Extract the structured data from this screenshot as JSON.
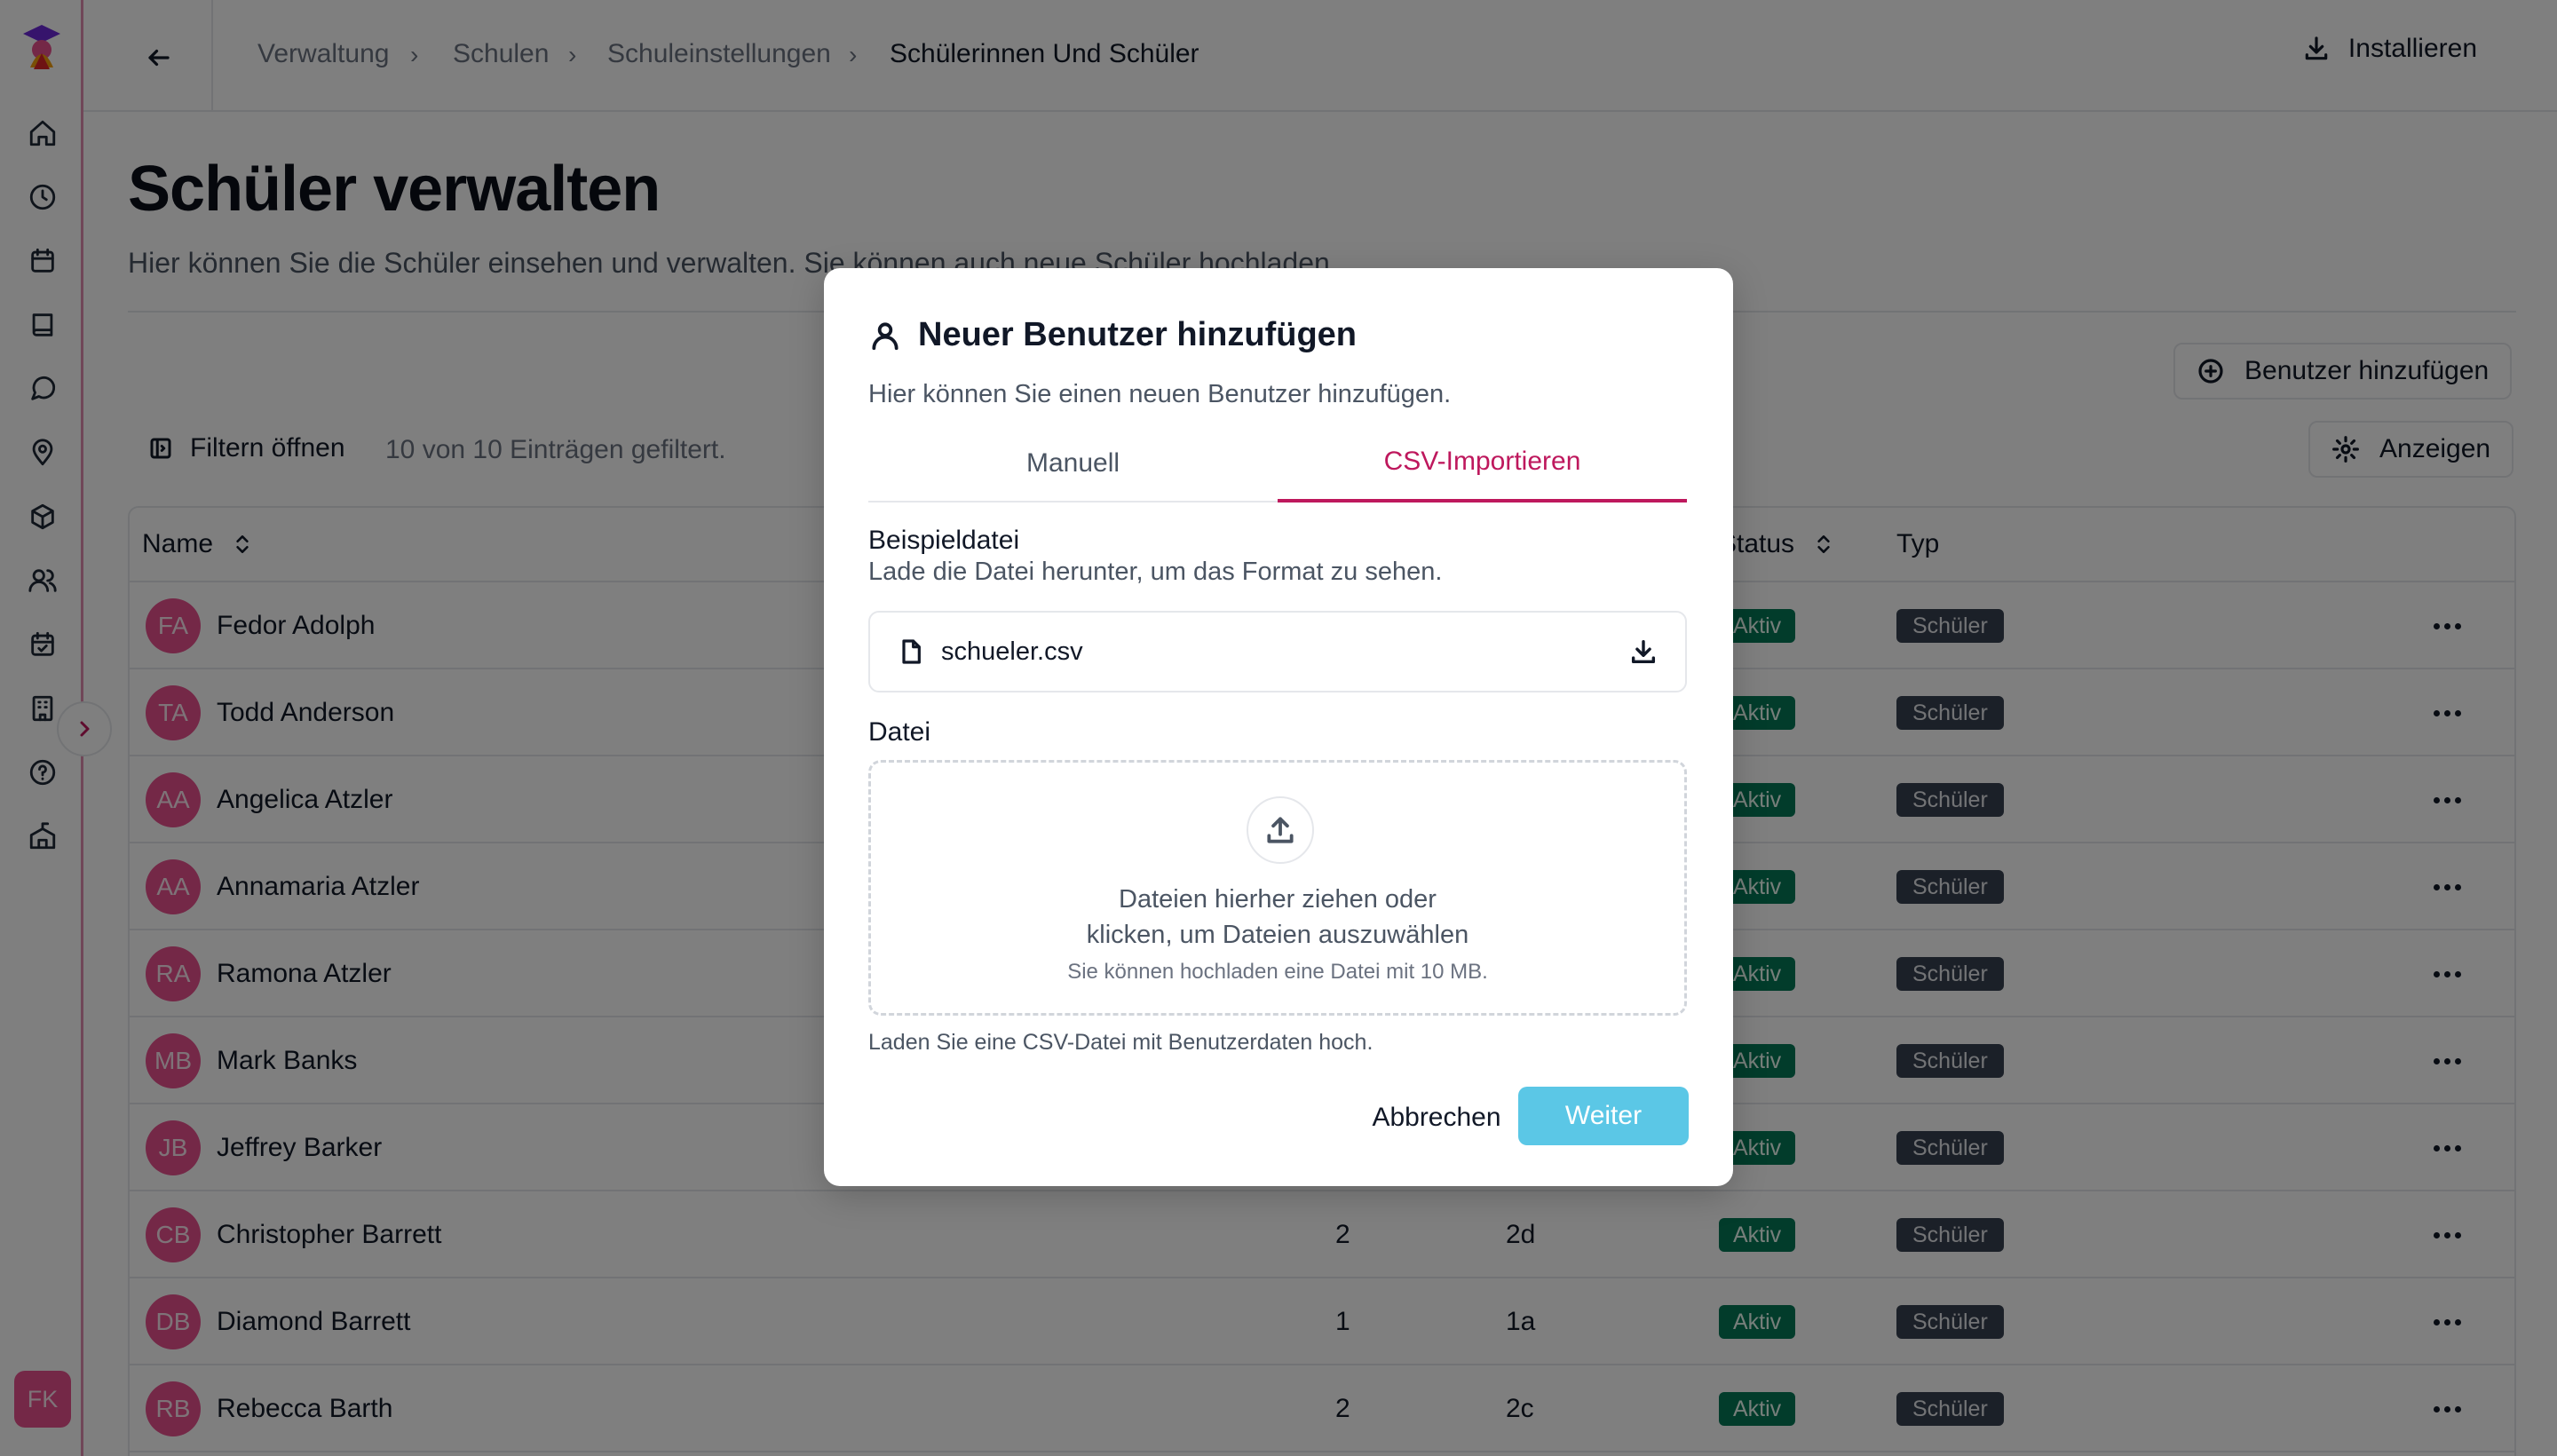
{
  "user": {
    "initials": "FK"
  },
  "breadcrumb": [
    "Verwaltung",
    "Schulen",
    "Schuleinstellungen",
    "Schülerinnen Und Schüler"
  ],
  "header": {
    "install_label": "Installieren"
  },
  "page": {
    "title": "Schüler verwalten",
    "description": "Hier können Sie die Schüler einsehen und verwalten. Sie können auch neue Schüler hochladen."
  },
  "toolbar": {
    "add_user_label": "Benutzer hinzufügen",
    "filter_label": "Filtern öffnen",
    "filter_count": "10 von 10 Einträgen gefiltert.",
    "view_label": "Anzeigen"
  },
  "table": {
    "headers": {
      "name": "Name",
      "status": "Status",
      "type": "Typ"
    },
    "rows": [
      {
        "initials": "FA",
        "name": "Fedor Adolph",
        "c1": "",
        "c2": "",
        "status": "Aktiv",
        "type": "Schüler"
      },
      {
        "initials": "TA",
        "name": "Todd Anderson",
        "c1": "",
        "c2": "",
        "status": "Aktiv",
        "type": "Schüler"
      },
      {
        "initials": "AA",
        "name": "Angelica Atzler",
        "c1": "",
        "c2": "",
        "status": "Aktiv",
        "type": "Schüler"
      },
      {
        "initials": "AA",
        "name": "Annamaria Atzler",
        "c1": "",
        "c2": "",
        "status": "Aktiv",
        "type": "Schüler"
      },
      {
        "initials": "RA",
        "name": "Ramona Atzler",
        "c1": "",
        "c2": "",
        "status": "Aktiv",
        "type": "Schüler"
      },
      {
        "initials": "MB",
        "name": "Mark Banks",
        "c1": "",
        "c2": "",
        "status": "Aktiv",
        "type": "Schüler"
      },
      {
        "initials": "JB",
        "name": "Jeffrey Barker",
        "c1": "",
        "c2": "",
        "status": "Aktiv",
        "type": "Schüler"
      },
      {
        "initials": "CB",
        "name": "Christopher Barrett",
        "c1": "2",
        "c2": "2d",
        "status": "Aktiv",
        "type": "Schüler"
      },
      {
        "initials": "DB",
        "name": "Diamond Barrett",
        "c1": "1",
        "c2": "1a",
        "status": "Aktiv",
        "type": "Schüler"
      },
      {
        "initials": "RB",
        "name": "Rebecca Barth",
        "c1": "2",
        "c2": "2c",
        "status": "Aktiv",
        "type": "Schüler"
      }
    ]
  },
  "dialog": {
    "title": "Neuer Benutzer hinzufügen",
    "description": "Hier können Sie einen neuen Benutzer hinzufügen.",
    "tabs": [
      {
        "label": "Manuell",
        "active": false
      },
      {
        "label": "CSV-Importieren",
        "active": true
      }
    ],
    "example_label": "Beispieldatei",
    "example_sub": "Lade die Datei herunter, um das Format zu sehen.",
    "example_file": "schueler.csv",
    "file_label": "Datei",
    "drop_line1": "Dateien hierher ziehen oder",
    "drop_line2": "klicken, um Dateien auszuwählen",
    "drop_small": "Sie können hochladen eine Datei mit 10 MB.",
    "hint": "Laden Sie eine CSV-Datei mit Benutzerdaten hoch.",
    "cancel_label": "Abbrechen",
    "next_label": "Weiter"
  },
  "colors": {
    "accent": "#be185d",
    "avatar": "#e8508f",
    "status_active": "#047857",
    "type_badge": "#374151",
    "primary_button": "#5bc7e6"
  }
}
